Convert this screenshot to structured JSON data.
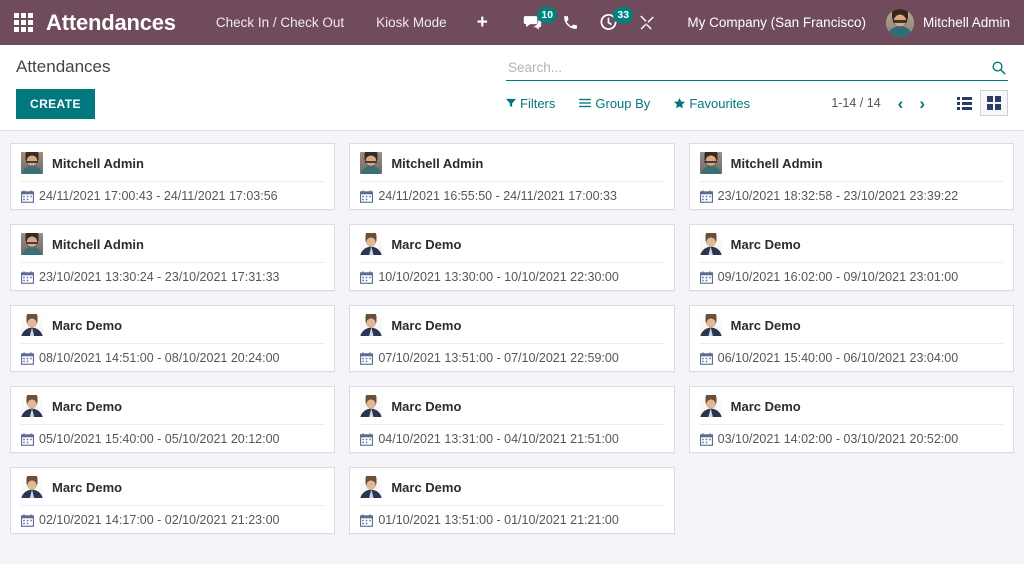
{
  "navbar": {
    "apps_icon": "grid-apps-icon",
    "brand": "Attendances",
    "menus": [
      {
        "label": "Check In / Check Out"
      },
      {
        "label": "Kiosk Mode"
      }
    ],
    "plus_label": "+",
    "systray": [
      {
        "icon": "messaging-icon",
        "badge": "10"
      },
      {
        "icon": "phone-icon",
        "badge": ""
      },
      {
        "icon": "activity-clock-icon",
        "badge": "33"
      },
      {
        "icon": "developer-tools-icon",
        "badge": ""
      }
    ],
    "company": "My Company (San Francisco)",
    "user": "Mitchell Admin",
    "background_color": "#6f4b5c"
  },
  "control_panel": {
    "breadcrumb": "Attendances",
    "create_label": "CREATE",
    "search": {
      "placeholder": "Search...",
      "value": "",
      "icon": "search-icon"
    },
    "filters_label": "Filters",
    "group_by_label": "Group By",
    "favourites_label": "Favourites",
    "pager": "1-14 / 14",
    "pager_previous": "‹",
    "pager_next": "›",
    "views": [
      {
        "name": "list",
        "icon": "list-view-icon",
        "active": false
      },
      {
        "name": "kanban",
        "icon": "kanban-view-icon",
        "active": true
      }
    ],
    "accent_color": "#00787d"
  },
  "kanban": {
    "cards": [
      {
        "employee": "Mitchell Admin",
        "avatar": "face-admin",
        "check_in": "24/11/2021 17:00:43",
        "check_out": "24/11/2021 17:03:56",
        "dates": "24/11/2021 17:00:43 - 24/11/2021 17:03:56"
      },
      {
        "employee": "Mitchell Admin",
        "avatar": "face-admin",
        "check_in": "24/11/2021 16:55:50",
        "check_out": "24/11/2021 17:00:33",
        "dates": "24/11/2021 16:55:50 - 24/11/2021 17:00:33"
      },
      {
        "employee": "Mitchell Admin",
        "avatar": "face-admin",
        "check_in": "23/10/2021 18:32:58",
        "check_out": "23/10/2021 23:39:22",
        "dates": "23/10/2021 18:32:58 - 23/10/2021 23:39:22"
      },
      {
        "employee": "Mitchell Admin",
        "avatar": "face-admin",
        "check_in": "23/10/2021 13:30:24",
        "check_out": "23/10/2021 17:31:33",
        "dates": "23/10/2021 13:30:24 - 23/10/2021 17:31:33"
      },
      {
        "employee": "Marc Demo",
        "avatar": "face-marc",
        "check_in": "10/10/2021 13:30:00",
        "check_out": "10/10/2021 22:30:00",
        "dates": "10/10/2021 13:30:00 - 10/10/2021 22:30:00"
      },
      {
        "employee": "Marc Demo",
        "avatar": "face-marc",
        "check_in": "09/10/2021 16:02:00",
        "check_out": "09/10/2021 23:01:00",
        "dates": "09/10/2021 16:02:00 - 09/10/2021 23:01:00"
      },
      {
        "employee": "Marc Demo",
        "avatar": "face-marc",
        "check_in": "08/10/2021 14:51:00",
        "check_out": "08/10/2021 20:24:00",
        "dates": "08/10/2021 14:51:00 - 08/10/2021 20:24:00"
      },
      {
        "employee": "Marc Demo",
        "avatar": "face-marc",
        "check_in": "07/10/2021 13:51:00",
        "check_out": "07/10/2021 22:59:00",
        "dates": "07/10/2021 13:51:00 - 07/10/2021 22:59:00"
      },
      {
        "employee": "Marc Demo",
        "avatar": "face-marc",
        "check_in": "06/10/2021 15:40:00",
        "check_out": "06/10/2021 23:04:00",
        "dates": "06/10/2021 15:40:00 - 06/10/2021 23:04:00"
      },
      {
        "employee": "Marc Demo",
        "avatar": "face-marc",
        "check_in": "05/10/2021 15:40:00",
        "check_out": "05/10/2021 20:12:00",
        "dates": "05/10/2021 15:40:00 - 05/10/2021 20:12:00"
      },
      {
        "employee": "Marc Demo",
        "avatar": "face-marc",
        "check_in": "04/10/2021 13:31:00",
        "check_out": "04/10/2021 21:51:00",
        "dates": "04/10/2021 13:31:00 - 04/10/2021 21:51:00"
      },
      {
        "employee": "Marc Demo",
        "avatar": "face-marc",
        "check_in": "03/10/2021 14:02:00",
        "check_out": "03/10/2021 20:52:00",
        "dates": "03/10/2021 14:02:00 - 03/10/2021 20:52:00"
      },
      {
        "employee": "Marc Demo",
        "avatar": "face-marc",
        "check_in": "02/10/2021 14:17:00",
        "check_out": "02/10/2021 21:23:00",
        "dates": "02/10/2021 14:17:00 - 02/10/2021 21:23:00"
      },
      {
        "employee": "Marc Demo",
        "avatar": "face-marc",
        "check_in": "01/10/2021 13:51:00",
        "check_out": "01/10/2021 21:21:00",
        "dates": "01/10/2021 13:51:00 - 01/10/2021 21:21:00"
      }
    ],
    "calendar_icon": "calendar-icon",
    "background_color": "#f5f5f9"
  }
}
